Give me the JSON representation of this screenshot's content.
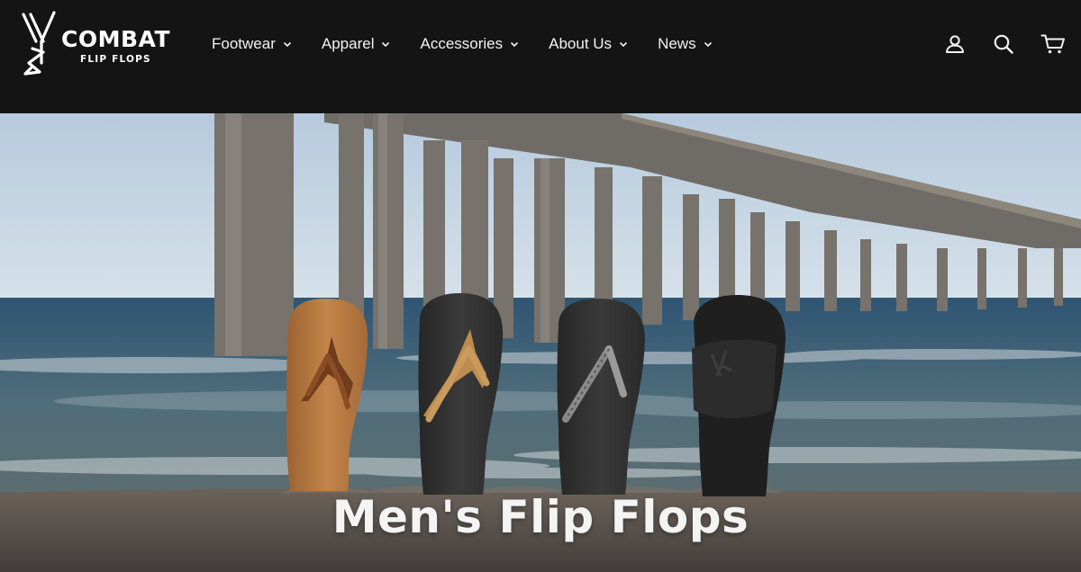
{
  "brand": {
    "name": "COMBAT",
    "tagline": "FLIP FLOPS"
  },
  "nav": {
    "items": [
      {
        "label": "Footwear"
      },
      {
        "label": "Apparel"
      },
      {
        "label": "Accessories"
      },
      {
        "label": "About Us"
      },
      {
        "label": "News"
      }
    ]
  },
  "utility": {
    "icons": [
      "account-icon",
      "search-icon",
      "cart-icon"
    ]
  },
  "hero": {
    "title": "Men's Flip Flops",
    "image_subject": "four flip flops standing in beach sand in front of a pier",
    "product_colors": [
      "#b7773f",
      "#2f2f2f",
      "#353535",
      "#262626"
    ]
  },
  "colors": {
    "header_bg": "#141414",
    "text_light": "#f2f2f2",
    "sky": "#c9d8e6",
    "ocean": "#4d6b80",
    "sand": "#5a5450"
  }
}
